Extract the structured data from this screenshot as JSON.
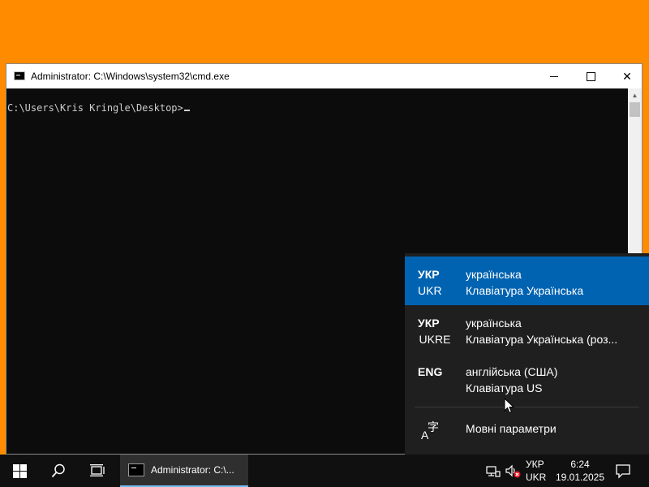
{
  "colors": {
    "desktop": "#ff8c00",
    "console_bg": "#0c0c0c",
    "flyout_bg": "#1f1f1f",
    "selected_item": "#0063b1",
    "taskbar_bg": "#101010"
  },
  "window": {
    "title": "Administrator: C:\\Windows\\system32\\cmd.exe",
    "icon": "cmd-icon",
    "minimize_glyph": "",
    "close_glyph": "✕"
  },
  "console": {
    "prompt": "C:\\Users\\Kris Kringle\\Desktop>"
  },
  "language_flyout": {
    "items": [
      {
        "code": "УКР",
        "sub": "UKR",
        "name": "українська",
        "keyboard": "Клавіатура Українська",
        "selected": true
      },
      {
        "code": "УКР",
        "sub": "UKRE",
        "name": "українська",
        "keyboard": "Клавіатура Українська (роз...",
        "selected": false
      },
      {
        "code": "ENG",
        "sub": "",
        "name": "англійська (США)",
        "keyboard": "Клавіатура US",
        "selected": false
      }
    ],
    "settings": {
      "icon": "language-settings-icon",
      "glyph_a": "A",
      "glyph_b": "字",
      "label": "Мовні параметри"
    }
  },
  "taskbar": {
    "start_icon": "windows-start-icon",
    "search_icon": "search-icon",
    "taskview_icon": "task-view-icon",
    "app_label": "Administrator: C:\\...",
    "tray": {
      "lang_top": "УКР",
      "lang_bottom": "UKR",
      "time": "6:24",
      "date": "19.01.2025"
    }
  }
}
